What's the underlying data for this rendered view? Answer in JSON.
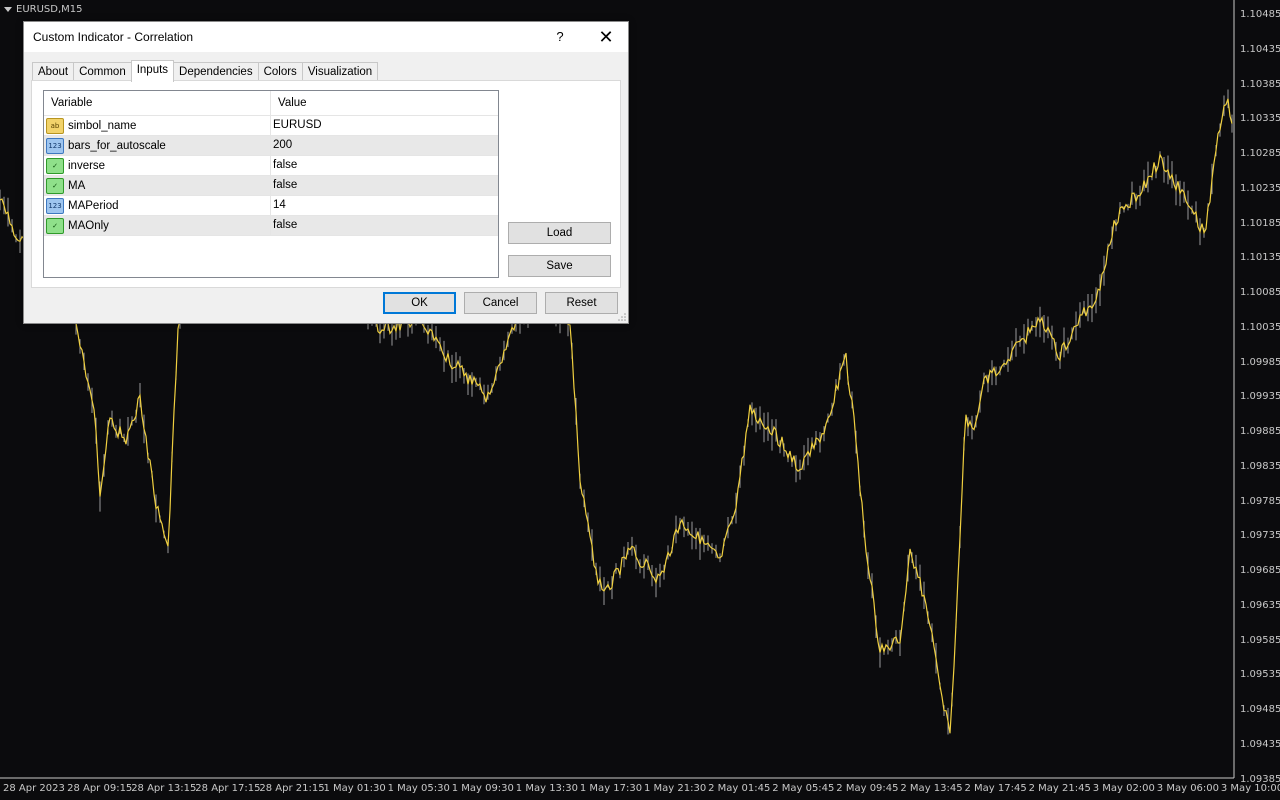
{
  "chart": {
    "symbol": "EURUSD,M15",
    "price_labels": [
      "1.10485",
      "1.10435",
      "1.10385",
      "1.10335",
      "1.10285",
      "1.10235",
      "1.10185",
      "1.10135",
      "1.10085",
      "1.10035",
      "1.09985",
      "1.09935",
      "1.09885",
      "1.09835",
      "1.09785",
      "1.09735",
      "1.09685",
      "1.09635",
      "1.09585",
      "1.09535",
      "1.09485",
      "1.09435",
      "1.09385"
    ],
    "time_labels": [
      "28 Apr 2023",
      "28 Apr 09:15",
      "28 Apr 13:15",
      "28 Apr 17:15",
      "28 Apr 21:15",
      "1 May 01:30",
      "1 May 05:30",
      "1 May 09:30",
      "1 May 13:30",
      "1 May 17:30",
      "1 May 21:30",
      "2 May 01:45",
      "2 May 05:45",
      "2 May 09:45",
      "2 May 13:45",
      "2 May 17:45",
      "2 May 21:45",
      "3 May 02:00",
      "3 May 06:00",
      "3 May 10:00"
    ],
    "colors": {
      "background": "#0b0b0d",
      "line": "#f0d040",
      "bars": "#9a9a9a",
      "text": "#c8c8c8"
    }
  },
  "dialog": {
    "title": "Custom Indicator - Correlation",
    "help_label": "?",
    "close_label": "✕",
    "tabs": [
      {
        "label": "About"
      },
      {
        "label": "Common"
      },
      {
        "label": "Inputs"
      },
      {
        "label": "Dependencies"
      },
      {
        "label": "Colors"
      },
      {
        "label": "Visualization"
      }
    ],
    "active_tab": "Inputs",
    "grid": {
      "headers": {
        "variable": "Variable",
        "value": "Value"
      },
      "rows": [
        {
          "icon": "string-type-icon",
          "icon_text": "ab",
          "name": "simbol_name",
          "value": "EURUSD"
        },
        {
          "icon": "integer-type-icon",
          "icon_text": "123",
          "name": "bars_for_autoscale",
          "value": "200"
        },
        {
          "icon": "boolean-type-icon",
          "icon_text": "✓",
          "name": "inverse",
          "value": "false"
        },
        {
          "icon": "boolean-type-icon",
          "icon_text": "✓",
          "name": "MA",
          "value": "false"
        },
        {
          "icon": "integer-type-icon",
          "icon_text": "123",
          "name": "MAPeriod",
          "value": "14"
        },
        {
          "icon": "boolean-type-icon",
          "icon_text": "✓",
          "name": "MAOnly",
          "value": "false"
        }
      ]
    },
    "buttons": {
      "load": "Load",
      "save": "Save",
      "ok": "OK",
      "cancel": "Cancel",
      "reset": "Reset"
    }
  }
}
